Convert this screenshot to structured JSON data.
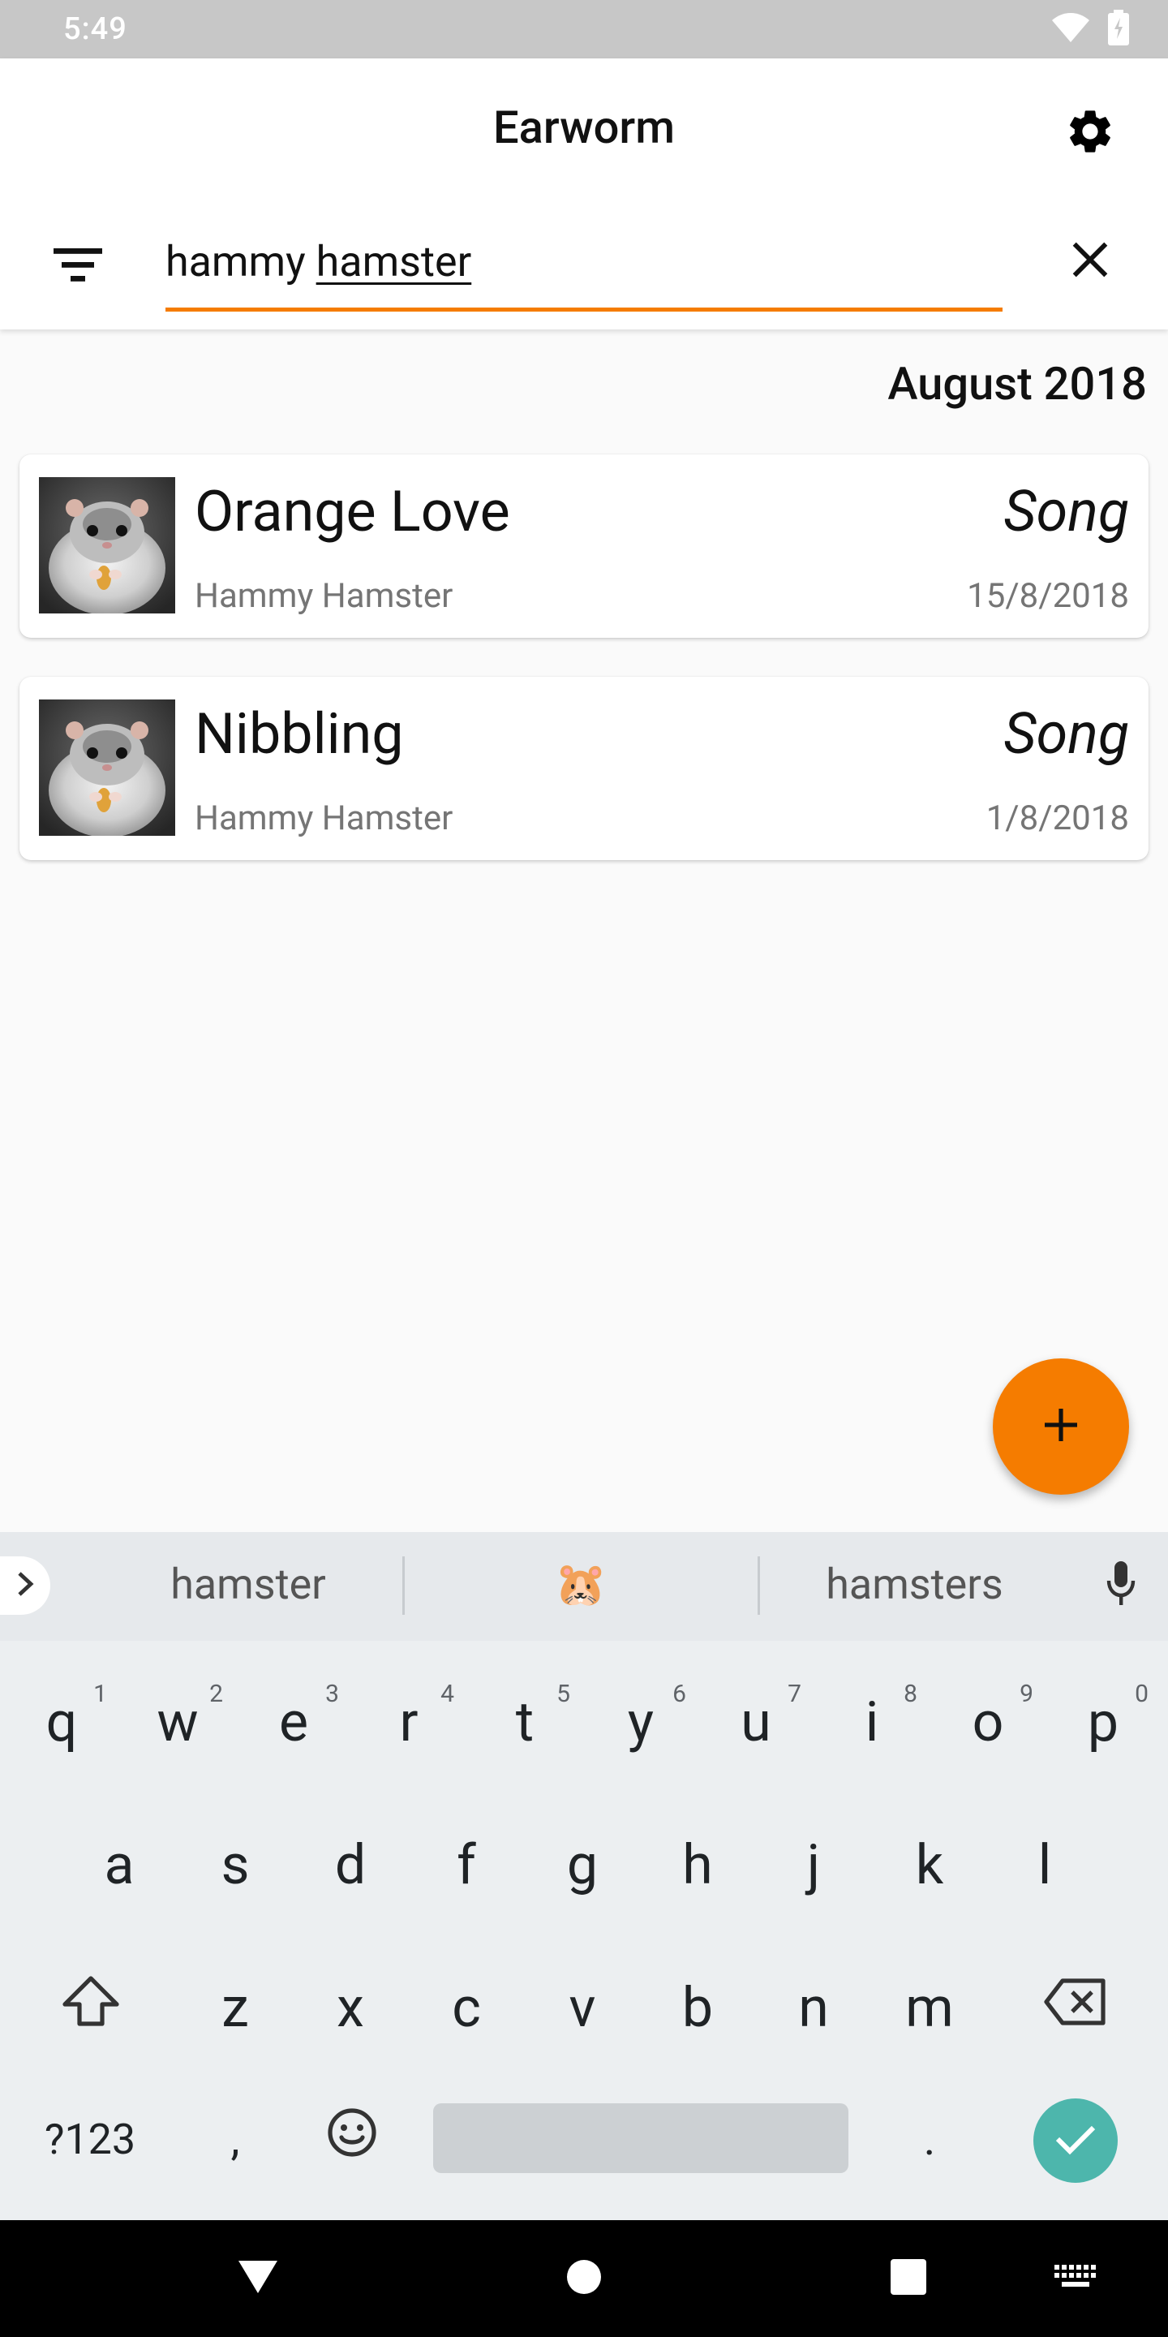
{
  "status_bar": {
    "time": "5:49"
  },
  "app_bar": {
    "title": "Earworm",
    "search": {
      "value_plain": "hammy ",
      "value_underlined": "hamster"
    }
  },
  "list": {
    "month_header": "August 2018",
    "items": [
      {
        "title": "Orange Love",
        "type": "Song",
        "artist": "Hammy Hamster",
        "date": "15/8/2018"
      },
      {
        "title": "Nibbling",
        "type": "Song",
        "artist": "Hammy Hamster",
        "date": "1/8/2018"
      }
    ]
  },
  "fab": {
    "icon": "plus-icon"
  },
  "keyboard": {
    "suggestions": [
      "hamster",
      "🐹",
      "hamsters"
    ],
    "row1": [
      {
        "key": "q",
        "hint": "1"
      },
      {
        "key": "w",
        "hint": "2"
      },
      {
        "key": "e",
        "hint": "3"
      },
      {
        "key": "r",
        "hint": "4"
      },
      {
        "key": "t",
        "hint": "5"
      },
      {
        "key": "y",
        "hint": "6"
      },
      {
        "key": "u",
        "hint": "7"
      },
      {
        "key": "i",
        "hint": "8"
      },
      {
        "key": "o",
        "hint": "9"
      },
      {
        "key": "p",
        "hint": "0"
      }
    ],
    "row2": [
      "a",
      "s",
      "d",
      "f",
      "g",
      "h",
      "j",
      "k",
      "l"
    ],
    "row3": [
      "z",
      "x",
      "c",
      "v",
      "b",
      "n",
      "m"
    ],
    "symbols_label": "?123",
    "comma": ",",
    "period": "."
  },
  "colors": {
    "accent": "#f57c00",
    "enter_key": "#4db6ac",
    "status_bar": "#c7c7c7",
    "nav_bar": "#000000"
  }
}
